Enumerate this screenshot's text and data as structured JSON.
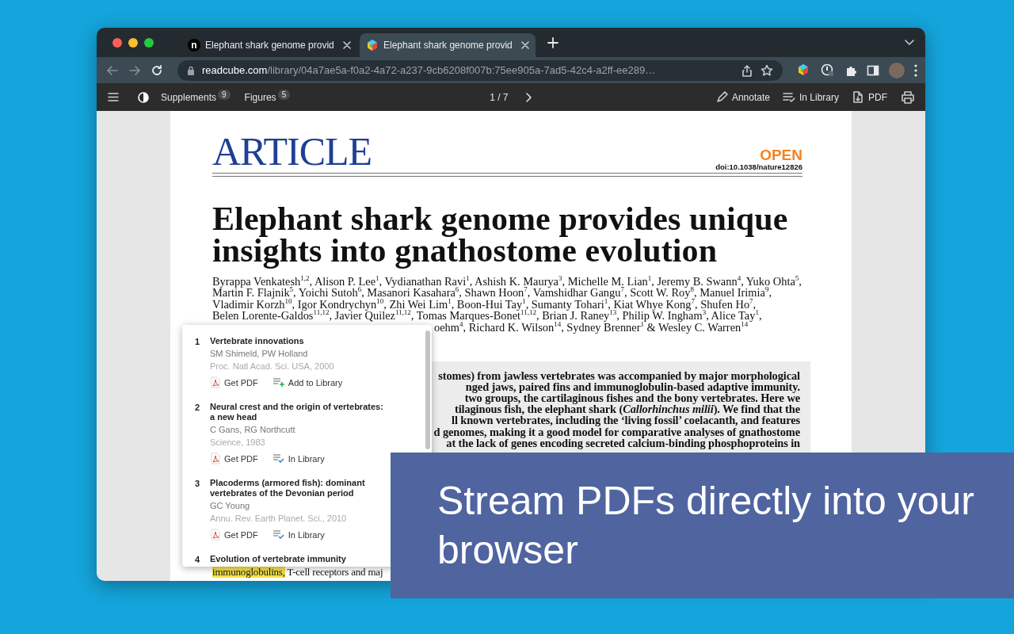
{
  "browser": {
    "tabs": [
      {
        "title": "Elephant shark genome provid",
        "favicon_text": "n",
        "selected": false
      },
      {
        "title": "Elephant shark genome provid",
        "selected": true
      }
    ],
    "url": {
      "host": "readcube.com",
      "path": "/library/04a7ae5a-f0a2-4a72-a237-9cb6208f007b:75ee905a-7ad5-42c4-a2ff-ee289…"
    }
  },
  "toolbar": {
    "links": [
      {
        "label": "Supplements",
        "count": "9"
      },
      {
        "label": "Figures",
        "count": "5"
      }
    ],
    "page": "1 / 7",
    "actions": [
      {
        "kind": "annotate",
        "label": "Annotate"
      },
      {
        "kind": "library",
        "label": "In Library"
      },
      {
        "kind": "pdf",
        "label": "PDF"
      }
    ]
  },
  "article": {
    "type": "ARTICLE",
    "access": "OPEN",
    "doi": "doi:10.1038/nature12826",
    "title_lines": [
      "Elephant shark genome provides unique",
      "insights into gnathostome evolution"
    ],
    "author_lines": [
      "Byrappa Venkatesh$^{1,2}$, Alison P. Lee$^{1}$, Vydianathan Ravi$^{1}$, Ashish K. Maurya$^{3}$, Michelle M. Lian$^{1}$, Jeremy B. Swann$^{4}$, Yuko Ohta$^{5}$,",
      "Martin F. Flajnik$^{5}$, Yoichi Sutoh$^{6}$, Masanori Kasahara$^{6}$, Shawn Hoon$^{7}$, Vamshidhar Gangu$^{7}$, Scott W. Roy$^{8}$, Manuel Irimia$^{9}$,",
      "Vladimir Korzh$^{10}$, Igor Kondrychyn$^{10}$, Zhi Wei Lim$^{1}$, Boon-Hui Tay$^{1}$, Sumanty Tohari$^{1}$, Kiat Whye Kong$^{7}$, Shufen Ho$^{7}$,",
      "Belen Lorente-Galdos$^{11,12}$, Javier Quilez$^{11,12}$, Tomas Marques-Bonet$^{11,12}$, Brian J. Raney$^{13}$, Philip W. Ingham$^{3}$, Alice Tay$^{1}$,",
      "oehm$^{4}$, Richard K. Wilson$^{14}$, Sydney Brenner$^{1}$ & Wesley C. Warren$^{14}$"
    ],
    "abstract_lines": [
      "stomes) from jawless vertebrates was accompanied by major morphological",
      "nged jaws, paired fins and immunoglobulin-based adaptive immunity.",
      "two groups, the cartilaginous fishes and the bony vertebrates. Here we",
      "tilaginous fish, the elephant shark (*Callorhinchus milii*). We find that the",
      "ll known vertebrates, including the ‘living fossil’ coelacanth, and features",
      "d genomes, making it a good model for comparative analyses of gnathostome",
      "at the lack of genes encoding secreted calcium-binding phosphoproteins in"
    ],
    "highlighted": {
      "highlight": "immunoglobulins,",
      "rest": " T-cell receptors and maj"
    }
  },
  "references": [
    {
      "number": "1",
      "title": "Vertebrate innovations",
      "authors": "SM Shimeld, PW Holland",
      "source": "Proc. Natl Acad. Sci. USA, 2000",
      "actions": [
        {
          "kind": "pdf",
          "label": "Get PDF"
        },
        {
          "kind": "add",
          "label": "Add to Library"
        }
      ]
    },
    {
      "number": "2",
      "title": "Neural crest and the origin of vertebrates: a new head",
      "authors": "C Gans, RG Northcutt",
      "source": "Science, 1983",
      "actions": [
        {
          "kind": "pdf",
          "label": "Get PDF"
        },
        {
          "kind": "in-library",
          "label": "In Library"
        }
      ]
    },
    {
      "number": "3",
      "title": "Placoderms (armored fish): dominant vertebrates of the Devonian period",
      "authors": "GC Young",
      "source": "Annu. Rev. Earth Planet. Sci., 2010",
      "actions": [
        {
          "kind": "pdf",
          "label": "Get PDF"
        },
        {
          "kind": "in-library",
          "label": "In Library"
        }
      ]
    },
    {
      "number": "4",
      "title": "Evolution of vertebrate immunity"
    }
  ],
  "banner": {
    "text": "Stream PDFs directly into your browser"
  }
}
